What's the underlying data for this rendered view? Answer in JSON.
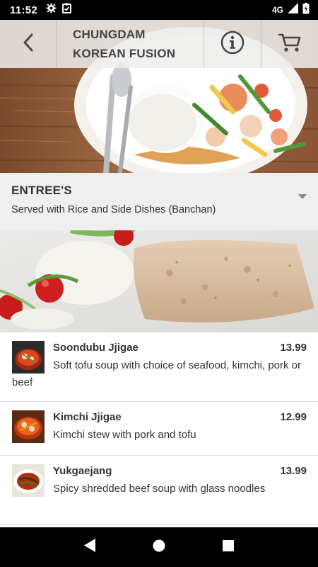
{
  "status_bar": {
    "time": "11:52",
    "network": "4G",
    "icons_left": [
      "gear-icon",
      "clipboard-check-icon"
    ],
    "icons_right": [
      "signal-icon",
      "battery-icon"
    ]
  },
  "header": {
    "title_line1": "CHUNGDAM",
    "title_line2": "KOREAN FUSION",
    "back_icon": "chevron-left-icon",
    "info_icon": "info-circle-icon",
    "cart_icon": "cart-icon"
  },
  "category": {
    "title": "ENTREE'S",
    "subtitle": "Served with Rice and Side Dishes (Banchan)",
    "caret_icon": "caret-down-icon"
  },
  "menu_items": [
    {
      "name": "Soondubu Jjigae",
      "price": "13.99",
      "description": "Soft tofu soup with choice of seafood, kimchi, pork or beef"
    },
    {
      "name": "Kimchi Jjigae",
      "price": "12.99",
      "description": "Kimchi stew with pork and tofu"
    },
    {
      "name": "Yukgaejang",
      "price": "13.99",
      "description": "Spicy shredded beef soup with glass noodles"
    }
  ],
  "nav_bar": {
    "buttons": [
      "back-triangle-icon",
      "home-circle-icon",
      "recents-square-icon"
    ]
  },
  "colors": {
    "status_bar": "#000000",
    "header_overlay": "#eeeeec",
    "category_bg": "#efefef",
    "text": "#333333",
    "divider": "#dcdcdc"
  }
}
